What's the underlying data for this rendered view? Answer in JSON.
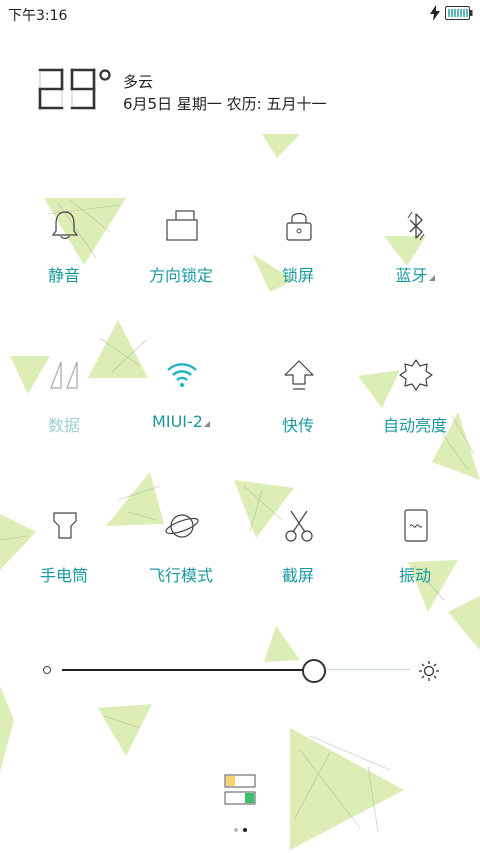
{
  "status_bar": {
    "time": "下午3:16"
  },
  "weather": {
    "temperature": "29",
    "condition": "多云",
    "date": "6月5日 星期一 农历: 五月十一"
  },
  "toggles": {
    "silent": "静音",
    "rotation_lock": "方向锁定",
    "lock_screen": "锁屏",
    "bluetooth": "蓝牙",
    "data": "数据",
    "wifi": "MIUI-2",
    "quick_send": "快传",
    "auto_brightness": "自动亮度",
    "flashlight": "手电筒",
    "airplane_mode": "飞行模式",
    "screenshot": "截屏",
    "vibrate": "振动"
  },
  "brightness": {
    "level": 0.72
  },
  "pager": {
    "pages": 2,
    "current": 2
  },
  "colors": {
    "accent": "#1a9aa0",
    "wallpaper_triangle": "#d9ebb4",
    "wifi_icon": "#22b4c0",
    "toggle_yellow": "#f5d26a",
    "toggle_green": "#3cc06e"
  }
}
